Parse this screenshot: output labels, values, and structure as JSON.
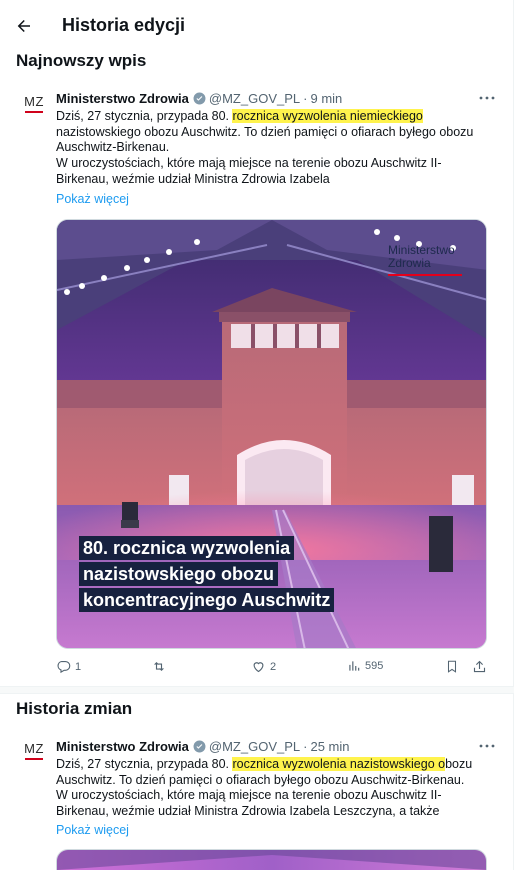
{
  "header": {
    "title": "Historia edycji"
  },
  "latest": {
    "section_title": "Najnowszy wpis",
    "avatar_text": "MZ",
    "author": "Ministerstwo Zdrowia",
    "handle": "@MZ_GOV_PL",
    "dot": "·",
    "time": "9 min",
    "text_pre": "Dziś, 27 stycznia, przypada 80. ",
    "text_hl": "rocznica wyzwolenia niemieckiego",
    "text_post": " nazistowskiego obozu Auschwitz. To dzień pamięci o ofiarach byłego obozu Auschwitz-Birkenau.",
    "text_p2": "W uroczystościach, które mają miejsce na terenie obozu Auschwitz II-Birkenau, weźmie udział Ministra Zdrowia Izabela",
    "show_more": "Pokaż więcej",
    "media": {
      "brand_line1": "Ministerstwo",
      "brand_line2": "Zdrowia",
      "caption_1": "80. rocznica wyzwolenia",
      "caption_2": "nazistowskiego obozu",
      "caption_3": "koncentracyjnego Auschwitz"
    },
    "actions": {
      "replies": "1",
      "reposts": "",
      "likes": "2",
      "views": "595"
    }
  },
  "history": {
    "section_title": "Historia zmian",
    "avatar_text": "MZ",
    "author": "Ministerstwo Zdrowia",
    "handle": "@MZ_GOV_PL",
    "dot": "·",
    "time": "25 min",
    "text_pre": "Dziś, 27 stycznia, przypada 80. ",
    "text_hl": "rocznica wyzwolenia nazistowskiego o",
    "text_post": "bozu Auschwitz. To dzień pamięci o ofiarach byłego obozu Auschwitz-Birkenau.",
    "text_p2": "W uroczystościach, które mają miejsce na terenie obozu Auschwitz II-Birkenau, weźmie udział Ministra Zdrowia Izabela Leszczyna, a także",
    "show_more": "Pokaż więcej"
  },
  "colors": {
    "accent": "#1d9bf0",
    "highlight": "#fff34d",
    "brand_red": "#e3001b",
    "caption_bg": "#17213f"
  },
  "icons": [
    "back-arrow-icon",
    "verified-badge-icon",
    "more-icon",
    "reply-icon",
    "repost-icon",
    "like-icon",
    "views-icon",
    "bookmark-icon",
    "share-icon"
  ]
}
